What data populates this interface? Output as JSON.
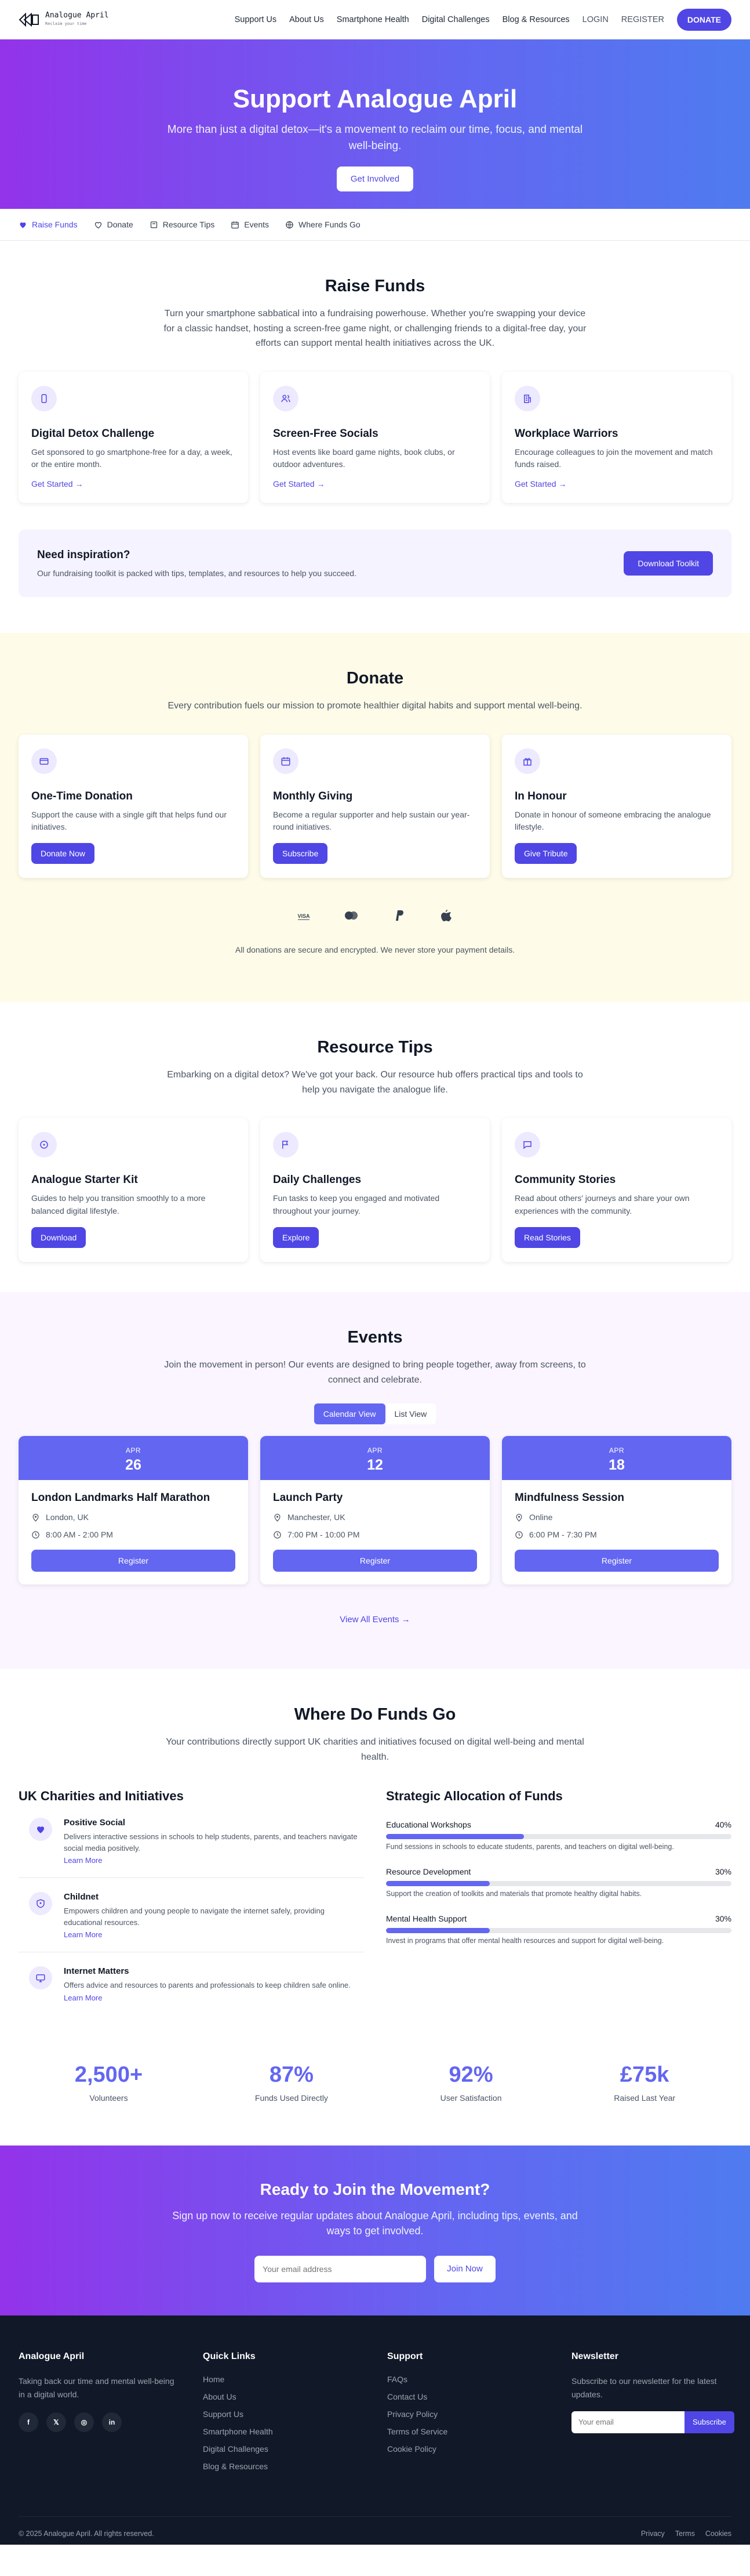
{
  "header": {
    "logo_text": "Analogue April",
    "logo_sub": "Reclaim your time",
    "nav": [
      "Support Us",
      "About Us",
      "Smartphone Health",
      "Digital Challenges",
      "Blog & Resources"
    ],
    "login": "LOGIN",
    "register": "REGISTER",
    "donate": "DONATE"
  },
  "hero": {
    "title": "Support Analogue April",
    "subtitle": "More than just a digital detox—it's a movement to reclaim our time, focus, and mental well-being.",
    "cta": "Get Involved"
  },
  "tabs": [
    {
      "label": "Raise Funds",
      "icon": "heart-icon"
    },
    {
      "label": "Donate",
      "icon": "heart-outline-icon"
    },
    {
      "label": "Resource Tips",
      "icon": "book-icon"
    },
    {
      "label": "Events",
      "icon": "calendar-icon"
    },
    {
      "label": "Where Funds Go",
      "icon": "globe-icon"
    }
  ],
  "raise": {
    "title": "Raise Funds",
    "lead": "Turn your smartphone sabbatical into a fundraising powerhouse. Whether you're swapping your device for a classic handset, hosting a screen-free game night, or challenging friends to a digital-free day, your efforts can support mental health initiatives across the UK.",
    "cards": [
      {
        "title": "Digital Detox Challenge",
        "text": "Get sponsored to go smartphone-free for a day, a week, or the entire month.",
        "link": "Get Started →",
        "icon": "phone-icon"
      },
      {
        "title": "Screen-Free Socials",
        "text": "Host events like board game nights, book clubs, or outdoor adventures.",
        "link": "Get Started →",
        "icon": "users-icon"
      },
      {
        "title": "Workplace Warriors",
        "text": "Encourage colleagues to join the movement and match funds raised.",
        "link": "Get Started →",
        "icon": "building-icon"
      }
    ],
    "inspire_title": "Need inspiration?",
    "inspire_text": "Our fundraising toolkit is packed with tips, templates, and resources to help you succeed.",
    "inspire_btn": "Download Toolkit"
  },
  "donate": {
    "title": "Donate",
    "lead": "Every contribution fuels our mission to promote healthier digital habits and support mental well-being.",
    "cards": [
      {
        "title": "One-Time Donation",
        "text": "Support the cause with a single gift that helps fund our initiatives.",
        "btn": "Donate Now",
        "icon": "card-icon"
      },
      {
        "title": "Monthly Giving",
        "text": "Become a regular supporter and help sustain our year-round initiatives.",
        "btn": "Subscribe",
        "icon": "calendar-icon"
      },
      {
        "title": "In Honour",
        "text": "Donate in honour of someone embracing the analogue lifestyle.",
        "btn": "Give Tribute",
        "icon": "gift-icon"
      }
    ],
    "payments": [
      "visa-icon",
      "mastercard-icon",
      "paypal-icon",
      "apple-icon"
    ],
    "visa": "VISA",
    "secure": "All donations are secure and encrypted. We never store your payment details."
  },
  "resources": {
    "title": "Resource Tips",
    "lead": "Embarking on a digital detox? We've got your back. Our resource hub offers practical tips and tools to help you navigate the analogue life.",
    "cards": [
      {
        "title": "Analogue Starter Kit",
        "text": "Guides to help you transition smoothly to a more balanced digital lifestyle.",
        "btn": "Download",
        "icon": "compass-icon"
      },
      {
        "title": "Daily Challenges",
        "text": "Fun tasks to keep you engaged and motivated throughout your journey.",
        "btn": "Explore",
        "icon": "flag-icon"
      },
      {
        "title": "Community Stories",
        "text": "Read about others' journeys and share your own experiences with the community.",
        "btn": "Read Stories",
        "icon": "chat-icon"
      }
    ]
  },
  "events": {
    "title": "Events",
    "lead": "Join the movement in person! Our events are designed to bring people together, away from screens, to connect and celebrate.",
    "view_calendar": "Calendar View",
    "view_list": "List View",
    "items": [
      {
        "month": "APR",
        "day": "26",
        "title": "London Landmarks Half Marathon",
        "location": "London, UK",
        "time": "8:00 AM - 2:00 PM",
        "btn": "Register"
      },
      {
        "month": "APR",
        "day": "12",
        "title": "Launch Party",
        "location": "Manchester, UK",
        "time": "7:00 PM - 10:00 PM",
        "btn": "Register"
      },
      {
        "month": "APR",
        "day": "18",
        "title": "Mindfulness Session",
        "location": "Online",
        "time": "6:00 PM - 7:30 PM",
        "btn": "Register"
      }
    ],
    "view_all": "View All Events →"
  },
  "funds": {
    "title": "Where Do Funds Go",
    "lead": "Your contributions directly support UK charities and initiatives focused on digital well-being and mental health.",
    "charities_title": "UK Charities and Initiatives",
    "charities": [
      {
        "name": "Positive Social",
        "text": "Delivers interactive sessions in schools to help students, parents, and teachers navigate social media positively.",
        "link": "Learn More",
        "icon": "heart-icon"
      },
      {
        "name": "Childnet",
        "text": "Empowers children and young people to navigate the internet safely, providing educational resources.",
        "link": "Learn More",
        "icon": "shield-icon"
      },
      {
        "name": "Internet Matters",
        "text": "Offers advice and resources to parents and professionals to keep children safe online.",
        "link": "Learn More",
        "icon": "monitor-icon"
      }
    ],
    "alloc_title": "Strategic Allocation of Funds",
    "alloc": [
      {
        "label": "Educational Workshops",
        "pct_text": "40%",
        "pct": 40,
        "text": "Fund sessions in schools to educate students, parents, and teachers on digital well-being."
      },
      {
        "label": "Resource Development",
        "pct_text": "30%",
        "pct": 30,
        "text": "Support the creation of toolkits and materials that promote healthy digital habits."
      },
      {
        "label": "Mental Health Support",
        "pct_text": "30%",
        "pct": 30,
        "text": "Invest in programs that offer mental health resources and support for digital well-being."
      }
    ],
    "stats": [
      {
        "n": "2,500+",
        "l": "Volunteers"
      },
      {
        "n": "87%",
        "l": "Funds Used Directly"
      },
      {
        "n": "92%",
        "l": "User Satisfaction"
      },
      {
        "n": "£75k",
        "l": "Raised Last Year"
      }
    ]
  },
  "cta": {
    "title": "Ready to Join the Movement?",
    "text": "Sign up now to receive regular updates about Analogue April, including tips, events, and ways to get involved.",
    "placeholder": "Your email address",
    "btn": "Join Now"
  },
  "footer": {
    "brand": "Analogue April",
    "brand_text": "Taking back our time and mental well-being in a digital world.",
    "socials": [
      "f",
      "𝕏",
      "◎",
      "in"
    ],
    "quick_title": "Quick Links",
    "quick": [
      "Home",
      "About Us",
      "Support Us",
      "Smartphone Health",
      "Digital Challenges",
      "Blog & Resources"
    ],
    "support_title": "Support",
    "support": [
      "FAQs",
      "Contact Us",
      "Privacy Policy",
      "Terms of Service",
      "Cookie Policy"
    ],
    "news_title": "Newsletter",
    "news_text": "Subscribe to our newsletter for the latest updates.",
    "news_placeholder": "Your email",
    "news_btn": "Subscribe",
    "copyright": "© 2025 Analogue April. All rights reserved.",
    "bottom_links": [
      "Privacy",
      "Terms",
      "Cookies"
    ]
  },
  "colors": {
    "accent": "#4f46e5",
    "accent_light": "#6366f1",
    "hero_from": "#9333ea",
    "hero_to": "#4f7bf0",
    "donate_bg": "#fefce8",
    "events_bg": "#faf5ff",
    "footer_bg": "#111827"
  }
}
